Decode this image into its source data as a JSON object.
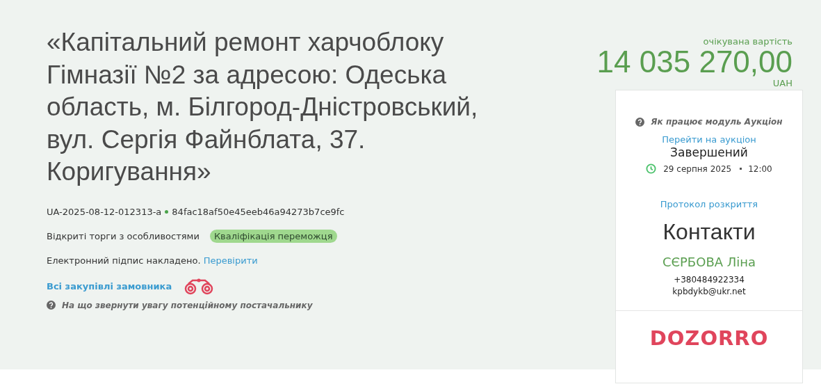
{
  "tender": {
    "title": "«Капітальний ремонт харчоблоку Гімназії №2 за адресою: Одеська область, м. Білгород-Дністровський, вул. Сергія Файнблата, 37. Коригування»",
    "id": "UA-2025-08-12-012313-a",
    "hash": "84fac18af50e45eeb46a94273b7ce9fc",
    "procedure": "Відкриті торги з особливостями",
    "status": {
      "label": "Кваліфікація переможця",
      "color": "#9fd88e"
    },
    "signature": "Електронний підпис накладено.",
    "signature_link": "Перевірити",
    "buyer_link": "Всі закупівлі замовника",
    "hint": "На що звернути увагу потенційному постачальнику"
  },
  "price": {
    "label": "очікувана вартість",
    "amount": "14 035 270,00",
    "currency": "UAH"
  },
  "card": {
    "auction_help": "Як працює модуль Аукціон",
    "auction_link": "Перейти на аукціон",
    "auction_status": "Завершений",
    "date": "29 серпня 2025",
    "time": "12:00",
    "protocol_link": "Протокол розкриття",
    "contacts_title": "Контакти",
    "contact_name": "СЄРБОВА Ліна",
    "phone": "+380484922334",
    "email": "kpbdykb@ukr.net",
    "logo": "DOZORRO"
  }
}
